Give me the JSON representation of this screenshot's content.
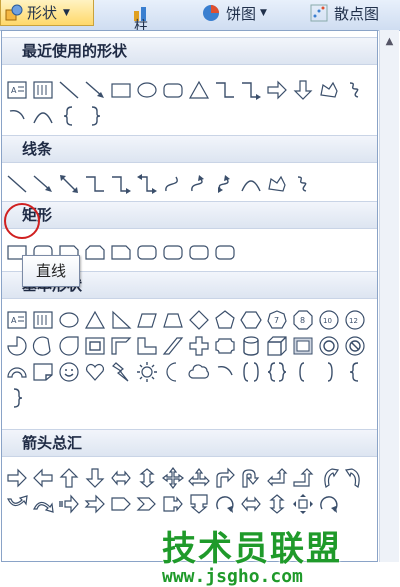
{
  "ribbon": {
    "shapes_label": "形状",
    "column_chart_label": "柱形图",
    "pie_chart_label": "饼图",
    "scatter_label": "散点图"
  },
  "sections": {
    "recent": "最近使用的形状",
    "lines": "线条",
    "rectangles": "矩形",
    "basic": "基本形状",
    "arrows": "箭头总汇"
  },
  "tooltip": "直线",
  "watermark": {
    "title": "技术员联盟",
    "url": "www.jsgho.com"
  }
}
